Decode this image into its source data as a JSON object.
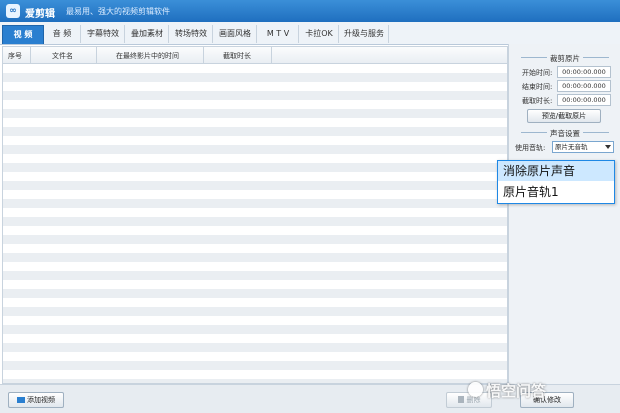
{
  "window": {
    "app_name": "爱剪辑",
    "slogan": "最易用、强大的视频剪辑软件",
    "logo_glyph": "∞"
  },
  "tabs": [
    {
      "label": "视 频",
      "active": true
    },
    {
      "label": "音 频"
    },
    {
      "label": "字幕特效"
    },
    {
      "label": "叠加素材"
    },
    {
      "label": "转场特效"
    },
    {
      "label": "画面风格"
    },
    {
      "label": "M T V"
    },
    {
      "label": "卡拉OK"
    },
    {
      "label": "升级与服务"
    }
  ],
  "list": {
    "columns": [
      "序号",
      "文件名",
      "在最终影片中的时间",
      "截取时长"
    ]
  },
  "right_panel": {
    "clip_section": "裁剪原片",
    "start_label": "开始时间:",
    "start_value": "00:00:00.000",
    "end_label": "结束时间:",
    "end_value": "00:00:00.000",
    "duration_label": "截取时长:",
    "duration_value": "00:00:00.000",
    "preview_button": "预览/截取原片",
    "audio_section": "声音设置",
    "track_label": "使用音轨:",
    "track_value": "原片无音轨"
  },
  "dropdown": {
    "options": [
      "消除原片声音",
      "原片音轨1"
    ],
    "selected_index": 0
  },
  "bottom": {
    "add_video_button": "添加视频",
    "delete_button": "删除",
    "confirm_button": "确认修改",
    "watermark": "悟空问答"
  }
}
